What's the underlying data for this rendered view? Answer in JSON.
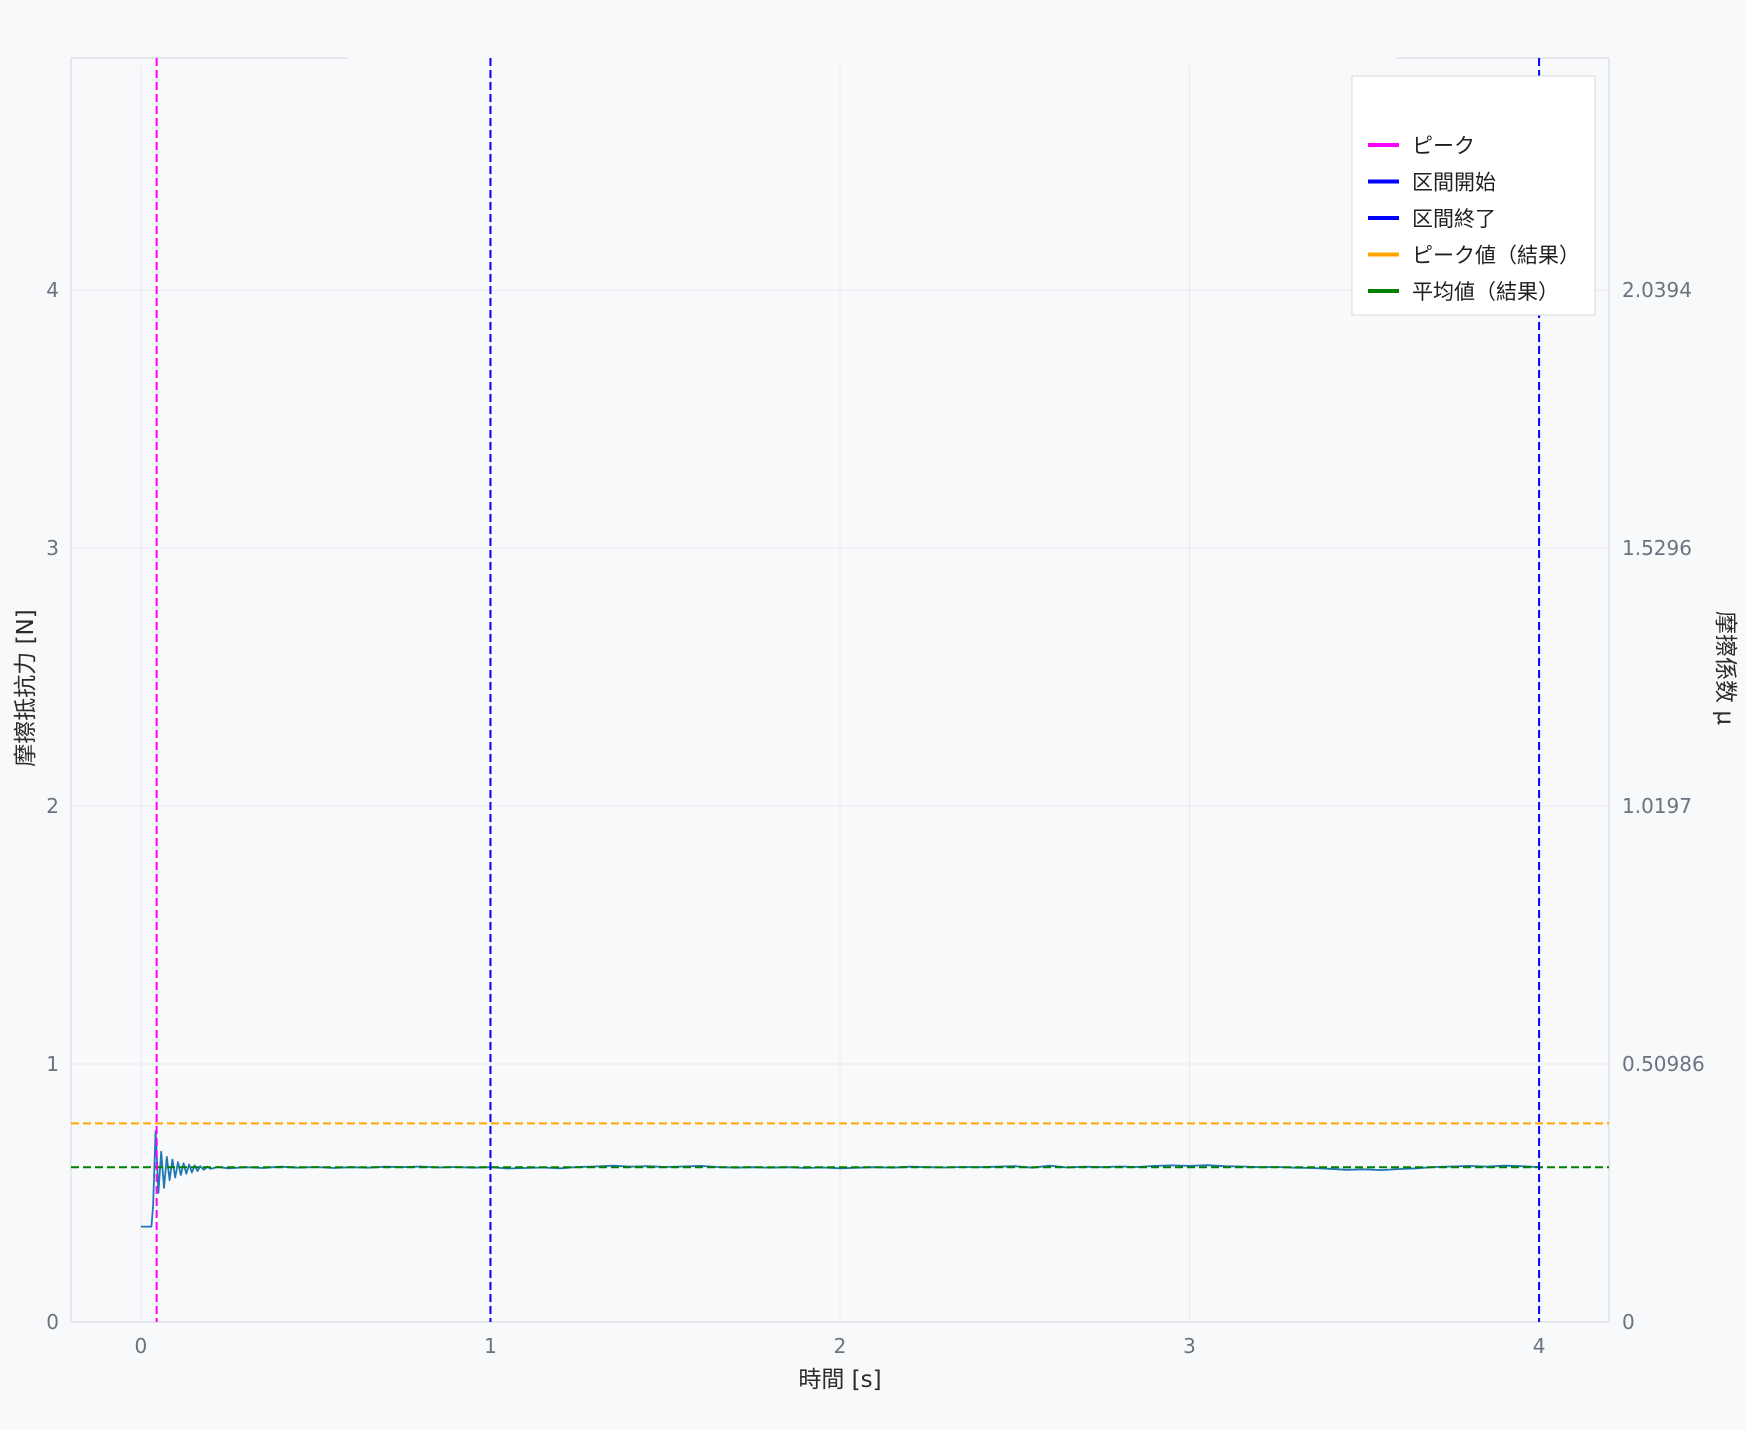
{
  "colors": {
    "signal": "#1f77b4",
    "peak": "#ff00ff",
    "interval": "#0000ff",
    "peak_value": "#ffa500",
    "mean_value": "#008000",
    "grid": "#e8eaee",
    "axis": "#d9dce1",
    "background": "#f8f9fb",
    "legend_bg": "#ffffff",
    "legend_border": "#d5d8de"
  },
  "chart_data": {
    "type": "line",
    "xlabel": "時間 [s]",
    "ylabel": "摩擦抵抗力 [N]",
    "y2label": "摩擦係数 μ",
    "xlim": [
      -0.2,
      4.2
    ],
    "ylim": [
      0,
      4.9
    ],
    "xticks": [
      0,
      1,
      2,
      3,
      4
    ],
    "yticks": [
      0,
      1,
      2,
      3,
      4
    ],
    "y2ticks": [
      {
        "value": 0,
        "label": "0"
      },
      {
        "value": 1,
        "label": "0.50986"
      },
      {
        "value": 2,
        "label": "1.0197"
      },
      {
        "value": 3,
        "label": "1.5296"
      },
      {
        "value": 4,
        "label": "2.0394"
      }
    ],
    "grid": true,
    "legend_position": "top-right",
    "legend": [
      "ピーク",
      "区間開始",
      "区間終了",
      "ピーク値（結果）",
      "平均値（結果）"
    ],
    "series": [
      {
        "points": [
          [
            0,
            0.37
          ],
          [
            0.03,
            0.37
          ],
          [
            0.035,
            0.45
          ],
          [
            0.042,
            0.74
          ],
          [
            0.05,
            0.5
          ],
          [
            0.058,
            0.66
          ],
          [
            0.066,
            0.52
          ],
          [
            0.074,
            0.64
          ],
          [
            0.082,
            0.55
          ],
          [
            0.09,
            0.63
          ],
          [
            0.098,
            0.56
          ],
          [
            0.106,
            0.62
          ],
          [
            0.114,
            0.57
          ],
          [
            0.122,
            0.615
          ],
          [
            0.13,
            0.575
          ],
          [
            0.138,
            0.61
          ],
          [
            0.146,
            0.58
          ],
          [
            0.154,
            0.607
          ],
          [
            0.162,
            0.585
          ],
          [
            0.17,
            0.604
          ],
          [
            0.18,
            0.59
          ],
          [
            0.19,
            0.602
          ],
          [
            0.2,
            0.594
          ],
          [
            0.22,
            0.601
          ],
          [
            0.25,
            0.596
          ],
          [
            0.3,
            0.6
          ],
          [
            0.35,
            0.597
          ],
          [
            0.4,
            0.602
          ],
          [
            0.45,
            0.598
          ],
          [
            0.5,
            0.601
          ],
          [
            0.55,
            0.597
          ],
          [
            0.6,
            0.6
          ],
          [
            0.65,
            0.598
          ],
          [
            0.7,
            0.602
          ],
          [
            0.75,
            0.6
          ],
          [
            0.8,
            0.603
          ],
          [
            0.85,
            0.599
          ],
          [
            0.9,
            0.601
          ],
          [
            0.95,
            0.598
          ],
          [
            1.0,
            0.6
          ],
          [
            1.05,
            0.595
          ],
          [
            1.1,
            0.597
          ],
          [
            1.15,
            0.599
          ],
          [
            1.2,
            0.596
          ],
          [
            1.25,
            0.601
          ],
          [
            1.3,
            0.603
          ],
          [
            1.35,
            0.606
          ],
          [
            1.4,
            0.602
          ],
          [
            1.45,
            0.604
          ],
          [
            1.5,
            0.601
          ],
          [
            1.55,
            0.603
          ],
          [
            1.6,
            0.605
          ],
          [
            1.65,
            0.601
          ],
          [
            1.7,
            0.598
          ],
          [
            1.75,
            0.6
          ],
          [
            1.8,
            0.598
          ],
          [
            1.85,
            0.6
          ],
          [
            1.9,
            0.597
          ],
          [
            1.95,
            0.599
          ],
          [
            2.0,
            0.596
          ],
          [
            2.05,
            0.598
          ],
          [
            2.1,
            0.6
          ],
          [
            2.15,
            0.598
          ],
          [
            2.2,
            0.602
          ],
          [
            2.25,
            0.6
          ],
          [
            2.3,
            0.599
          ],
          [
            2.35,
            0.601
          ],
          [
            2.4,
            0.6
          ],
          [
            2.45,
            0.602
          ],
          [
            2.5,
            0.604
          ],
          [
            2.55,
            0.598
          ],
          [
            2.6,
            0.606
          ],
          [
            2.65,
            0.599
          ],
          [
            2.7,
            0.602
          ],
          [
            2.75,
            0.6
          ],
          [
            2.8,
            0.603
          ],
          [
            2.85,
            0.601
          ],
          [
            2.9,
            0.605
          ],
          [
            2.95,
            0.607
          ],
          [
            3.0,
            0.605
          ],
          [
            3.05,
            0.608
          ],
          [
            3.1,
            0.604
          ],
          [
            3.15,
            0.603
          ],
          [
            3.2,
            0.6
          ],
          [
            3.25,
            0.601
          ],
          [
            3.3,
            0.598
          ],
          [
            3.35,
            0.597
          ],
          [
            3.4,
            0.594
          ],
          [
            3.45,
            0.59
          ],
          [
            3.5,
            0.592
          ],
          [
            3.55,
            0.589
          ],
          [
            3.6,
            0.593
          ],
          [
            3.65,
            0.596
          ],
          [
            3.7,
            0.601
          ],
          [
            3.75,
            0.603
          ],
          [
            3.8,
            0.605
          ],
          [
            3.85,
            0.602
          ],
          [
            3.9,
            0.606
          ],
          [
            3.95,
            0.604
          ],
          [
            4.0,
            0.6
          ]
        ]
      }
    ],
    "vlines": [
      {
        "label": "ピーク",
        "x": 0.045,
        "color": "#ff00ff"
      },
      {
        "label": "区間開始",
        "x": 1.0,
        "color": "#0000ff"
      },
      {
        "label": "区間終了",
        "x": 4.0,
        "color": "#0000ff"
      }
    ],
    "hlines": [
      {
        "label": "ピーク値（結果）",
        "y": 0.77,
        "color": "#ffa500"
      },
      {
        "label": "平均値（結果）",
        "y": 0.6,
        "color": "#008000"
      }
    ]
  }
}
